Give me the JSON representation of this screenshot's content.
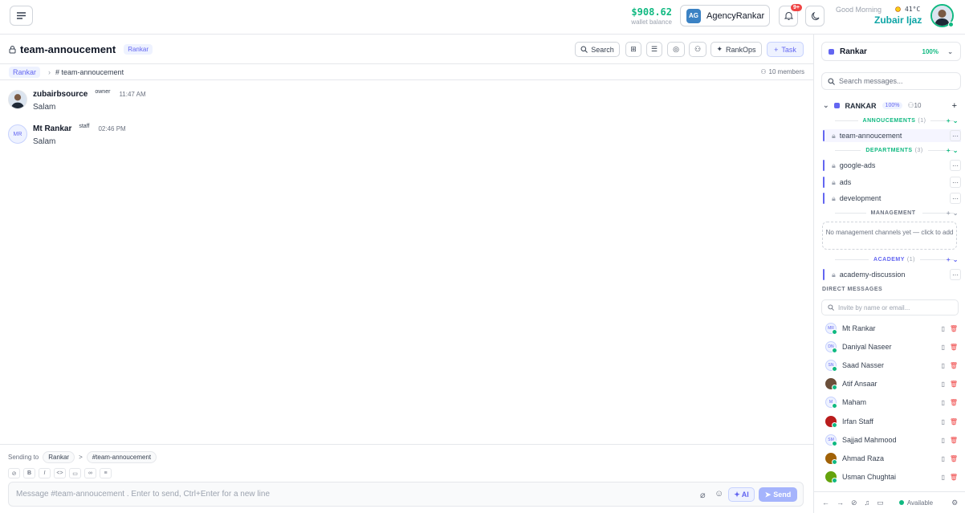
{
  "header": {
    "wallet_amount": "$908.62",
    "wallet_label": "wallet balance",
    "agency_initials": "AG",
    "agency_name": "AgencyRankar",
    "notif_badge": "9+",
    "greeting": "Good Morning",
    "temperature": "41°C",
    "user_name": "Zubair Ijaz"
  },
  "channel": {
    "name": "team-annoucement",
    "workspace_tag": "Rankar",
    "buttons": {
      "search": "Search",
      "rankops": "RankOps",
      "task": "Task"
    },
    "breadcrumb_workspace": "Rankar",
    "breadcrumb_channel": "# team-annoucement",
    "members": "10 members"
  },
  "messages": [
    {
      "author": "zubairbsource",
      "role": "owner",
      "time": "11:47 AM",
      "text": "Salam",
      "initials": ""
    },
    {
      "author": "Mt Rankar",
      "role": "staff",
      "time": "02:46 PM",
      "text": "Salam",
      "initials": "MR"
    }
  ],
  "composer": {
    "sending_to": "Sending to",
    "target_ws": "Rankar",
    "sep": ">",
    "target_channel": "#team-annoucement",
    "placeholder": "Message #team-annoucement . Enter to send, Ctrl+Enter for a new line",
    "ai_label": "AI",
    "send_label": "Send"
  },
  "sidebar": {
    "workspace": "Rankar",
    "workspace_pct": "100%",
    "search_placeholder": "Search messages...",
    "group_name": "RANKAR",
    "group_pct": "100%",
    "group_members": "10",
    "sections": [
      {
        "name": "ANNOUCEMENTS",
        "count": "(1)"
      },
      {
        "name": "DEPARTMENTS",
        "count": "(3)"
      },
      {
        "name": "MANAGEMENT",
        "count": ""
      },
      {
        "name": "ACADEMY",
        "count": "(1)"
      }
    ],
    "channels": [
      "team-annoucement",
      "google-ads",
      "ads",
      "development",
      "academy-discussion"
    ],
    "management_empty": "No management channels yet — click to add",
    "dm_header": "DIRECT MESSAGES",
    "dm_placeholder": "Invite by name or email...",
    "dms": [
      {
        "name": "Mt Rankar",
        "initials": "MR"
      },
      {
        "name": "Daniyal Naseer",
        "initials": "DN"
      },
      {
        "name": "Saad Nasser",
        "initials": "SN"
      },
      {
        "name": "Atif Ansaar",
        "initials": ""
      },
      {
        "name": "Maham",
        "initials": "M"
      },
      {
        "name": "Irfan Staff",
        "initials": ""
      },
      {
        "name": "Sajjad Mahmood",
        "initials": "SM"
      },
      {
        "name": "Ahmad Raza",
        "initials": ""
      },
      {
        "name": "Usman Chughtai",
        "initials": ""
      }
    ],
    "status": "Available"
  },
  "colors": {
    "accent": "#6366f1",
    "success": "#10b981",
    "danger": "#ef4444"
  }
}
